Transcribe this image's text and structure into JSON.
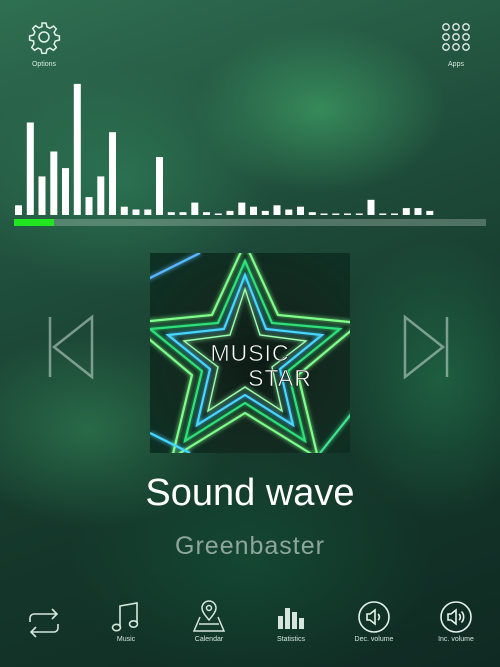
{
  "top": {
    "options_label": "Options",
    "apps_label": "Apps"
  },
  "visualizer": {
    "levels": [
      0.07,
      0.67,
      0.28,
      0.46,
      0.34,
      0.95,
      0.13,
      0.28,
      0.6,
      0.06,
      0.04,
      0.04,
      0.42,
      0.02,
      0.02,
      0.09,
      0.02,
      0.01,
      0.03,
      0.09,
      0.06,
      0.03,
      0.07,
      0.04,
      0.06,
      0.02,
      0.01,
      0.01,
      0.01,
      0.01,
      0.11,
      0.01,
      0.01,
      0.05,
      0.05,
      0.03
    ],
    "bar_color": "#ffffff"
  },
  "playback": {
    "progress": 0.085,
    "progress_color": "#21e51f"
  },
  "track": {
    "title": "Sound wave",
    "artist": "Greenbaster",
    "cover_text_line1": "MUSIC",
    "cover_text_line2": "STAR"
  },
  "bottom_bar": {
    "music_label": "Music",
    "calendar_label": "Calendar",
    "statistics_label": "Statistics",
    "dec_volume_label": "Dec. volume",
    "inc_volume_label": "Inc. volume"
  }
}
